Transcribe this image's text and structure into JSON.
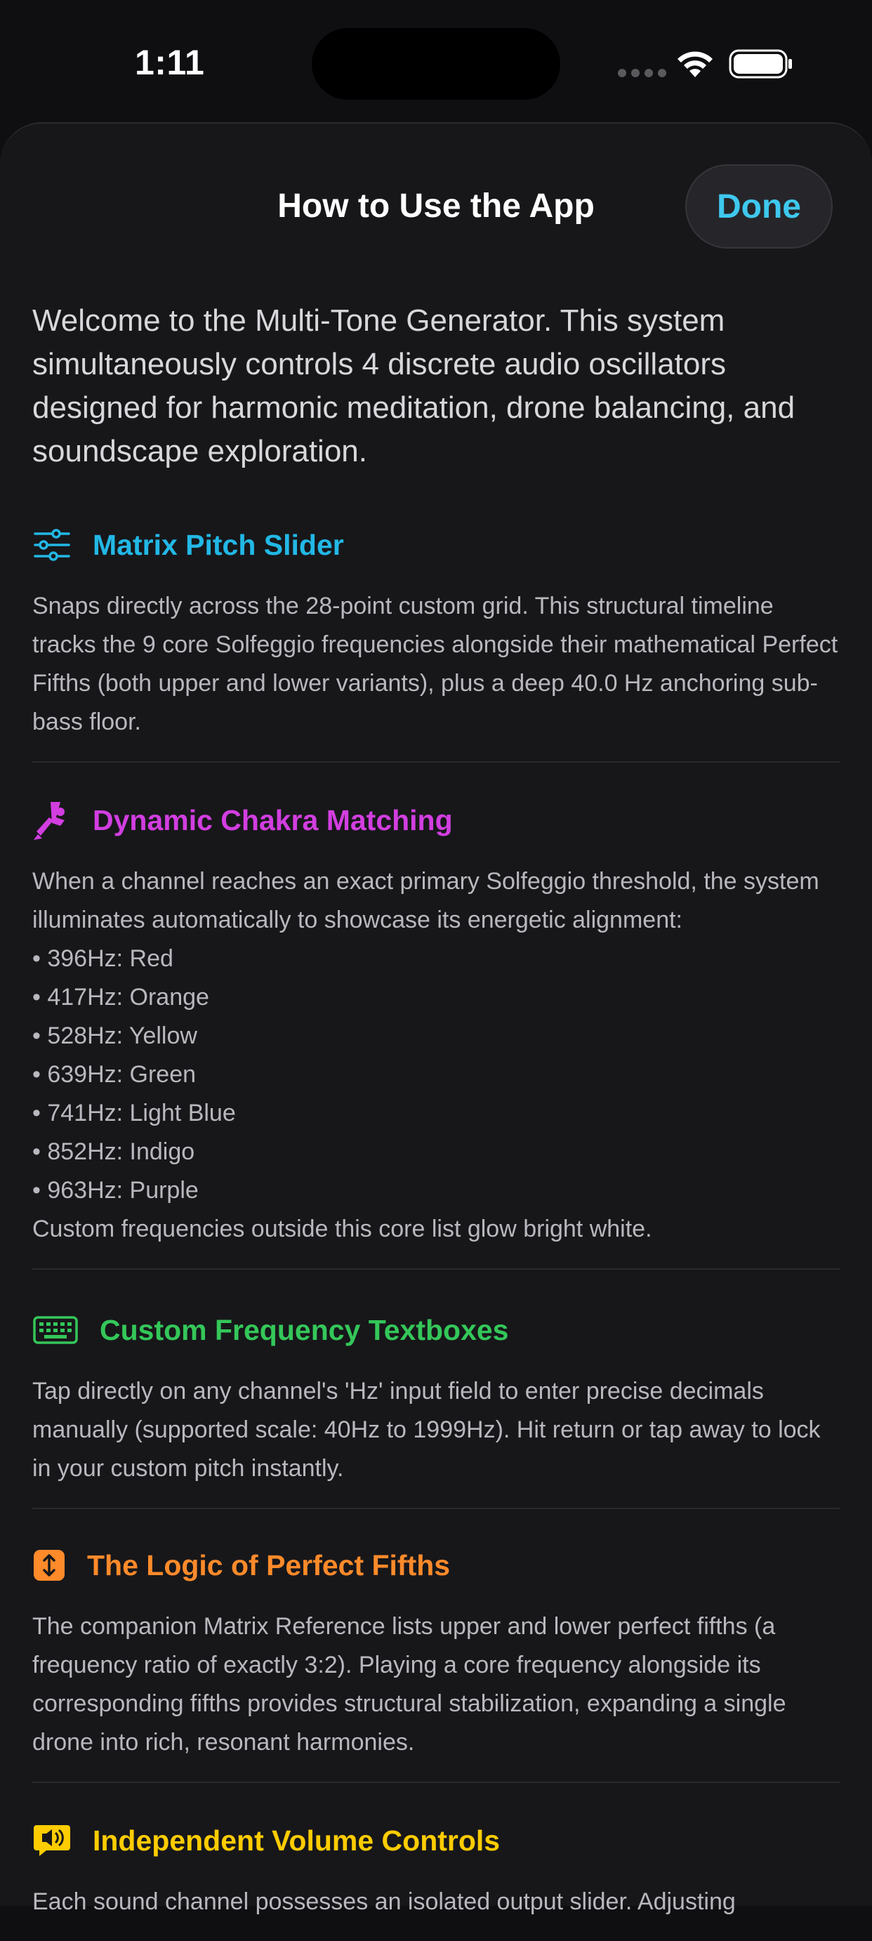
{
  "status_bar": {
    "time": "1:11"
  },
  "header": {
    "title": "How to Use the App",
    "done_label": "Done"
  },
  "intro": "Welcome to the Multi-Tone Generator. This system simultaneously controls 4 discrete audio oscillators designed for harmonic meditation, drone balancing, and soundscape exploration.",
  "colors": {
    "accent_cyan": "#3ec8ee",
    "matrix_title": "#22b8e6",
    "chakra_title": "#d23ee0",
    "custom_title": "#34c759",
    "fifths_title": "#ff8a2a",
    "volume_title": "#ffcc00"
  },
  "sections": [
    {
      "icon": "sliders-icon",
      "title": "Matrix Pitch Slider",
      "body": "Snaps directly across the 28-point custom grid. This structural timeline tracks the 9 core Solfeggio frequencies alongside their mathematical Perfect Fifths (both upper and lower variants), plus a deep 40.0 Hz anchoring sub-bass floor."
    },
    {
      "icon": "tuning-fork-icon",
      "title": "Dynamic Chakra Matching",
      "body": "When a channel reaches an exact primary Solfeggio threshold, the system illuminates automatically to showcase its energetic alignment:",
      "bullets": [
        "• 396Hz: Red",
        "• 417Hz: Orange",
        "• 528Hz: Yellow",
        "• 639Hz: Green",
        "• 741Hz: Light Blue",
        "• 852Hz: Indigo",
        "• 963Hz: Purple"
      ],
      "footer": "Custom frequencies outside this core list glow bright white."
    },
    {
      "icon": "keyboard-icon",
      "title": "Custom Frequency Textboxes",
      "body": "Tap directly on any channel's 'Hz' input field to enter precise decimals manually (supported scale: 40Hz to 1999Hz). Hit return or tap away to lock in your custom pitch instantly."
    },
    {
      "icon": "up-down-arrows-icon",
      "title": "The Logic of Perfect Fifths",
      "body": "The companion Matrix Reference lists upper and lower perfect fifths (a frequency ratio of exactly 3:2). Playing a core frequency alongside its corresponding fifths provides structural stabilization, expanding a single drone into rich, resonant harmonies."
    },
    {
      "icon": "speaker-bubble-icon",
      "title": "Independent Volume Controls",
      "body": "Each sound channel possesses an isolated output slider. Adjusting"
    }
  ]
}
